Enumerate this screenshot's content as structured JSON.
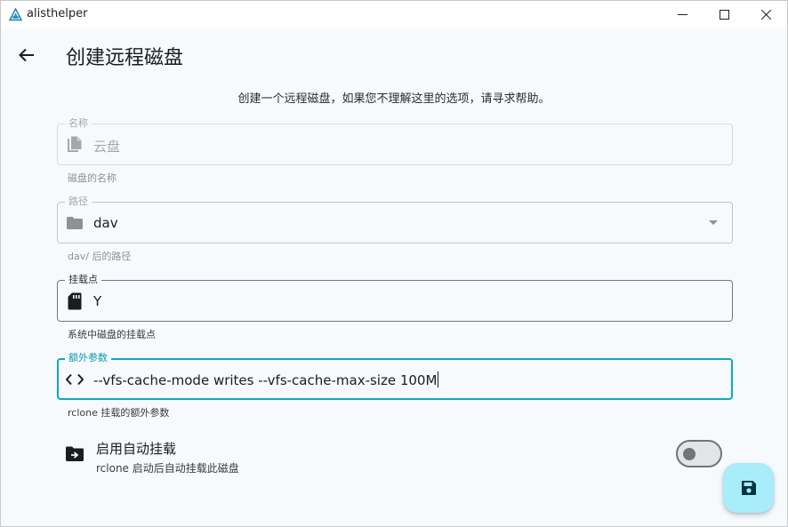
{
  "window": {
    "title": "alisthelper"
  },
  "page": {
    "title": "创建远程磁盘",
    "intro": "创建一个远程磁盘，如果您不理解这里的选项，请寻求帮助。"
  },
  "fields": {
    "name": {
      "label": "名称",
      "value": "云盘",
      "helper": "磁盘的名称",
      "icon": "file-copy-icon",
      "disabled": true
    },
    "path": {
      "label": "路径",
      "value": "dav",
      "helper": "dav/ 后的路径",
      "icon": "folder-icon"
    },
    "mount_point": {
      "label": "挂载点",
      "value": "Y",
      "helper": "系统中磁盘的挂载点",
      "icon": "sd-card-icon"
    },
    "extra_args": {
      "label": "额外参数",
      "value": "--vfs-cache-mode writes --vfs-cache-max-size 100M",
      "helper": "rclone 挂载的额外参数",
      "icon": "code-icon",
      "focused": true
    }
  },
  "auto_mount": {
    "title": "启用自动挂载",
    "subtitle": "rclone 启动后自动挂载此磁盘",
    "enabled": false
  },
  "colors": {
    "accent": "#10a7be",
    "fab": "#a9ecfa",
    "background": "#f6fafd"
  }
}
